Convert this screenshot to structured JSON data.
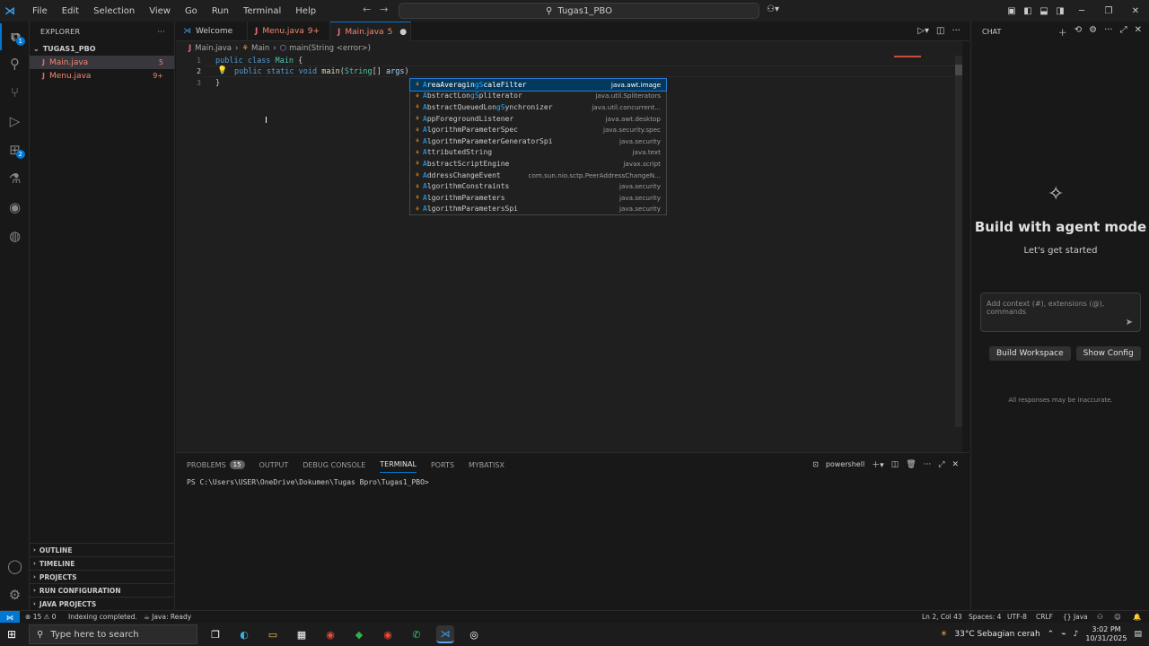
{
  "titlebar": {
    "menus": [
      "File",
      "Edit",
      "Selection",
      "View",
      "Go",
      "Run",
      "Terminal",
      "Help"
    ],
    "search_text": "Tugas1_PBO"
  },
  "explorer": {
    "header": "EXPLORER",
    "project": "TUGAS1_PBO",
    "files": [
      {
        "name": "Main.java",
        "count": "5"
      },
      {
        "name": "Menu.java",
        "count": "9+"
      }
    ],
    "sections": [
      "OUTLINE",
      "TIMELINE",
      "PROJECTS",
      "RUN CONFIGURATION",
      "JAVA PROJECTS"
    ]
  },
  "tabs": [
    {
      "label": "Welcome",
      "suffix": ""
    },
    {
      "label": "Menu.java",
      "suffix": "9+"
    },
    {
      "label": "Main.java",
      "suffix": "5"
    }
  ],
  "breadcrumb": [
    "Main.java",
    "Main",
    "main(String <error>)"
  ],
  "editor": {
    "line_numbers": [
      "1",
      "2",
      "3"
    ],
    "lines": [
      [
        "public",
        " class ",
        "Main",
        " {"
      ],
      [
        "public",
        " static ",
        "void",
        " ",
        "main",
        "(",
        "String",
        "[] ",
        "args",
        ")"
      ],
      [
        "}"
      ]
    ]
  },
  "suggestions": [
    {
      "pre": "",
      "hl": "A",
      "mid": "reaAveragin",
      "hl2": "gS",
      "post": "caleFilter",
      "pkg": "java.awt.image"
    },
    {
      "pre": "",
      "hl": "A",
      "mid": "bstractLon",
      "hl2": "gS",
      "post": "pliterator",
      "pkg": "java.util.Spliterators"
    },
    {
      "pre": "",
      "hl": "A",
      "mid": "bstractQueuedLon",
      "hl2": "gS",
      "post": "ynchronizer",
      "pkg": "java.util.concurrent..."
    },
    {
      "pre": "",
      "hl": "A",
      "mid": "ppForegroundListener",
      "hl2": "",
      "post": "",
      "pkg": "java.awt.desktop"
    },
    {
      "pre": "",
      "hl": "A",
      "mid": "lgorithmParameterSpec",
      "hl2": "",
      "post": "",
      "pkg": "java.security.spec"
    },
    {
      "pre": "",
      "hl": "A",
      "mid": "lgorithmParameterGeneratorSpi",
      "hl2": "",
      "post": "",
      "pkg": "java.security"
    },
    {
      "pre": "",
      "hl": "A",
      "mid": "ttributedString",
      "hl2": "",
      "post": "",
      "pkg": "java.text"
    },
    {
      "pre": "",
      "hl": "A",
      "mid": "bstractScriptEngine",
      "hl2": "",
      "post": "",
      "pkg": "javax.script"
    },
    {
      "pre": "",
      "hl": "A",
      "mid": "ddressChangeEvent",
      "hl2": "",
      "post": "",
      "pkg": "com.sun.nio.sctp.PeerAddressChangeN..."
    },
    {
      "pre": "",
      "hl": "A",
      "mid": "lgorithmConstraints",
      "hl2": "",
      "post": "",
      "pkg": "java.security"
    },
    {
      "pre": "",
      "hl": "A",
      "mid": "lgorithmParameters",
      "hl2": "",
      "post": "",
      "pkg": "java.security"
    },
    {
      "pre": "",
      "hl": "A",
      "mid": "lgorithmParametersSpi",
      "hl2": "",
      "post": "",
      "pkg": "java.security"
    }
  ],
  "panel": {
    "tabs": [
      "PROBLEMS",
      "OUTPUT",
      "DEBUG CONSOLE",
      "TERMINAL",
      "PORTS",
      "MYBATISX"
    ],
    "problems_count": "15",
    "shell": "powershell",
    "prompt": "PS C:\\Users\\USER\\OneDrive\\Dokumen\\Tugas Bpro\\Tugas1_PBO>"
  },
  "chat": {
    "header": "CHAT",
    "title": "Build with agent mode",
    "subtitle": "Let's get started",
    "input_placeholder": "Add context (#), extensions (@), commands",
    "buttons": [
      "Build Workspace",
      "Show Config"
    ],
    "note": "All responses may be inaccurate."
  },
  "statusbar": {
    "problems": "15",
    "warnings": "0",
    "indexing": "Indexing completed.",
    "java": "Java: Ready",
    "position": "Ln 2, Col 43",
    "spaces": "Spaces: 4",
    "encoding": "UTF-8",
    "eol": "CRLF",
    "language": "Java"
  },
  "taskbar": {
    "search_placeholder": "Type here to search",
    "weather": "33°C  Sebagian cerah",
    "time": "3:02 PM",
    "date": "10/31/2025"
  }
}
